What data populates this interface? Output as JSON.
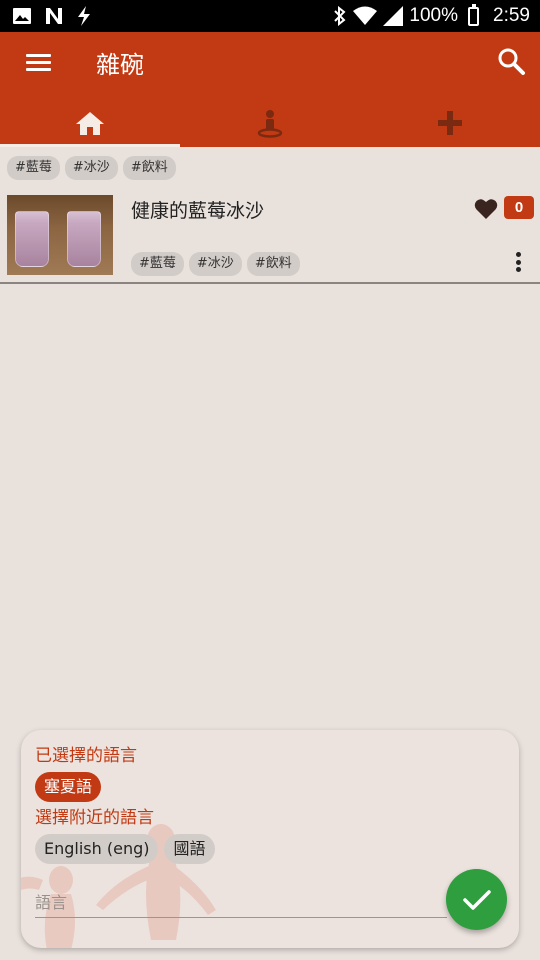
{
  "status_bar": {
    "battery": "100%",
    "time": "2:59",
    "icons": [
      "image-icon",
      "n-notification-icon",
      "flash-icon",
      "bluetooth-icon",
      "wifi-icon",
      "signal-icon",
      "battery-icon"
    ]
  },
  "app_bar": {
    "title": "雜碗",
    "menu_icon": "menu-icon",
    "search_icon": "search-icon",
    "background": "#c23a13"
  },
  "tabs": [
    {
      "icon": "home-icon",
      "active": true
    },
    {
      "icon": "person-icon",
      "active": false
    },
    {
      "icon": "add-icon",
      "active": false
    }
  ],
  "filters": {
    "chips": [
      "#藍莓",
      "#冰沙",
      "#飲料"
    ]
  },
  "recipes": [
    {
      "title": "健康的藍莓冰沙",
      "likes": "0",
      "tags": [
        "#藍莓",
        "#冰沙",
        "#飲料"
      ]
    }
  ],
  "language_panel": {
    "selected_label": "已選擇的語言",
    "selected_language": "塞夏語",
    "nearby_label": "選擇附近的語言",
    "nearby_languages": [
      "English (eng)",
      "國語"
    ],
    "input_placeholder": "語言",
    "input_value": ""
  },
  "colors": {
    "accent": "#c23a13",
    "confirm": "#2e9e3e",
    "background": "#e9e1dc"
  }
}
